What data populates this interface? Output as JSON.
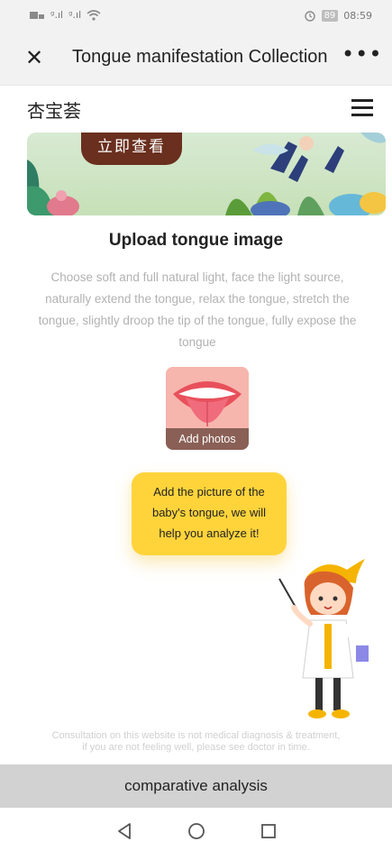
{
  "status_bar": {
    "time": "08:59",
    "battery": "89",
    "signal_text_1": "ᵍ.ıl",
    "signal_text_2": "ᵍ.ıl"
  },
  "titlebar": {
    "title": "Tongue manifestation Collection",
    "close_icon": "close-icon",
    "more_icon": "more-icon"
  },
  "app_header": {
    "name": "杏宝荟",
    "menu_icon": "hamburger-menu-icon"
  },
  "banner": {
    "button_label": "立即查看"
  },
  "upload": {
    "title": "Upload tongue image",
    "description": "Choose soft and full natural light, face the light source, naturally extend the tongue, relax the tongue, stretch the tongue, slightly droop the tip of the tongue, fully expose the tongue",
    "add_photos_label": "Add photos"
  },
  "bubble": {
    "text": "Add the picture of the baby's tongue, we will help you analyze it!"
  },
  "disclaimer": {
    "line1": "Consultation on this website is not medical diagnosis & treatment,",
    "line2": "if you are not feeling well, please see doctor in time."
  },
  "bottom_action": {
    "label": "comparative analysis"
  },
  "nav": {
    "back_icon": "back-triangle-icon",
    "home_icon": "home-circle-icon",
    "recent_icon": "recent-square-icon"
  },
  "colors": {
    "bubble": "#ffd43b",
    "banner_button": "#6a2f1e",
    "compare_bar": "#d2d2d2"
  }
}
